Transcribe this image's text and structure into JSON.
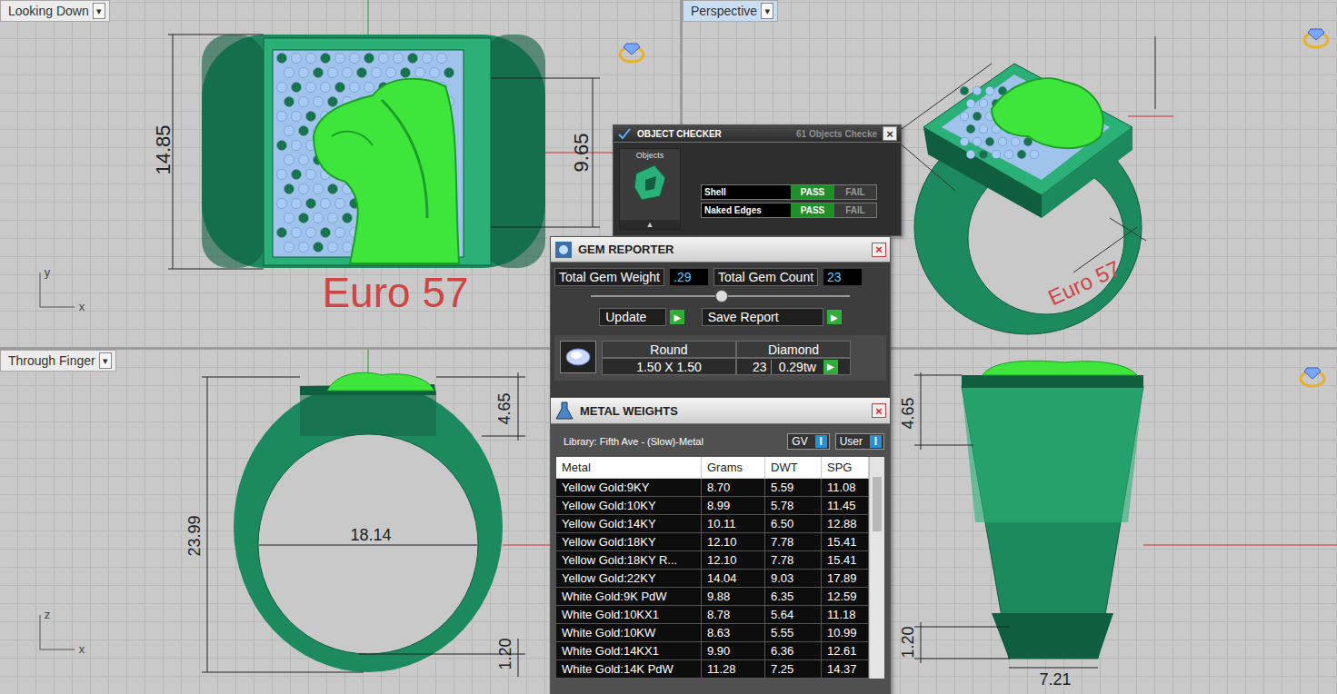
{
  "looking_down": {
    "label": "Looking Down",
    "arrow": "▾",
    "axes": [
      "y",
      "x"
    ],
    "dimensions": [
      "14.85",
      "9.65"
    ],
    "size_label": "Euro 57"
  },
  "perspective": {
    "label": "Perspective",
    "arrow": "▾",
    "size_label": "Euro 57"
  },
  "through_finger": {
    "label": "Through Finger",
    "arrow": "▾",
    "axes": [
      "z",
      "x"
    ],
    "dimensions": [
      "23.99",
      "18.14",
      "4.65",
      "1.20"
    ]
  },
  "side_view": {
    "dimensions": [
      "4.65",
      "1.20",
      "7.21"
    ]
  },
  "object_checker": {
    "title": "OBJECT CHECKER",
    "subtitle": "61 Objects Checke",
    "close": "×",
    "objects_label": "Objects",
    "expand": "▲",
    "checks": [
      {
        "name": "Shell",
        "pass": "PASS",
        "fail": "FAIL",
        "passed": true
      },
      {
        "name": "Naked Edges",
        "pass": "PASS",
        "fail": "FAIL",
        "passed": true
      }
    ]
  },
  "gem_reporter": {
    "title": "GEM REPORTER",
    "close": "×",
    "total_weight_label": "Total Gem Weight",
    "total_weight": ".29",
    "total_count_label": "Total Gem Count",
    "total_count": "23",
    "slider_level": 0.5,
    "buttons": [
      {
        "label": "Update",
        "icon": "▶"
      },
      {
        "label": "Save Report",
        "icon": "▶"
      }
    ],
    "gems": [
      {
        "shape": "Round",
        "size": "1.50 X 1.50",
        "material": "Diamond",
        "count": "23",
        "weight": "0.29tw",
        "icon": "▶"
      }
    ]
  },
  "metal_weights": {
    "title": "METAL WEIGHTS",
    "close": "×",
    "library": "Library: Fifth Ave - (Slow)-Metal",
    "toggles": [
      {
        "label": "GV",
        "value": "I"
      },
      {
        "label": "User",
        "value": "I"
      }
    ],
    "columns": [
      "Metal",
      "Grams",
      "DWT",
      "SPG"
    ],
    "rows": [
      [
        "Yellow Gold:9KY",
        "8.70",
        "5.59",
        "11.08"
      ],
      [
        "Yellow Gold:10KY",
        "8.99",
        "5.78",
        "11.45"
      ],
      [
        "Yellow Gold:14KY",
        "10.11",
        "6.50",
        "12.88"
      ],
      [
        "Yellow Gold:18KY",
        "12.10",
        "7.78",
        "15.41"
      ],
      [
        "Yellow Gold:18KY R...",
        "12.10",
        "7.78",
        "15.41"
      ],
      [
        "Yellow Gold:22KY",
        "14.04",
        "9.03",
        "17.89"
      ],
      [
        "White Gold:9K PdW",
        "9.88",
        "6.35",
        "12.59"
      ],
      [
        "White Gold:10KX1",
        "8.78",
        "5.64",
        "11.18"
      ],
      [
        "White Gold:10KW",
        "8.63",
        "5.55",
        "10.99"
      ],
      [
        "White Gold:14KX1",
        "9.90",
        "6.36",
        "12.61"
      ],
      [
        "White Gold:14K PdW",
        "11.28",
        "7.25",
        "14.37"
      ]
    ]
  }
}
